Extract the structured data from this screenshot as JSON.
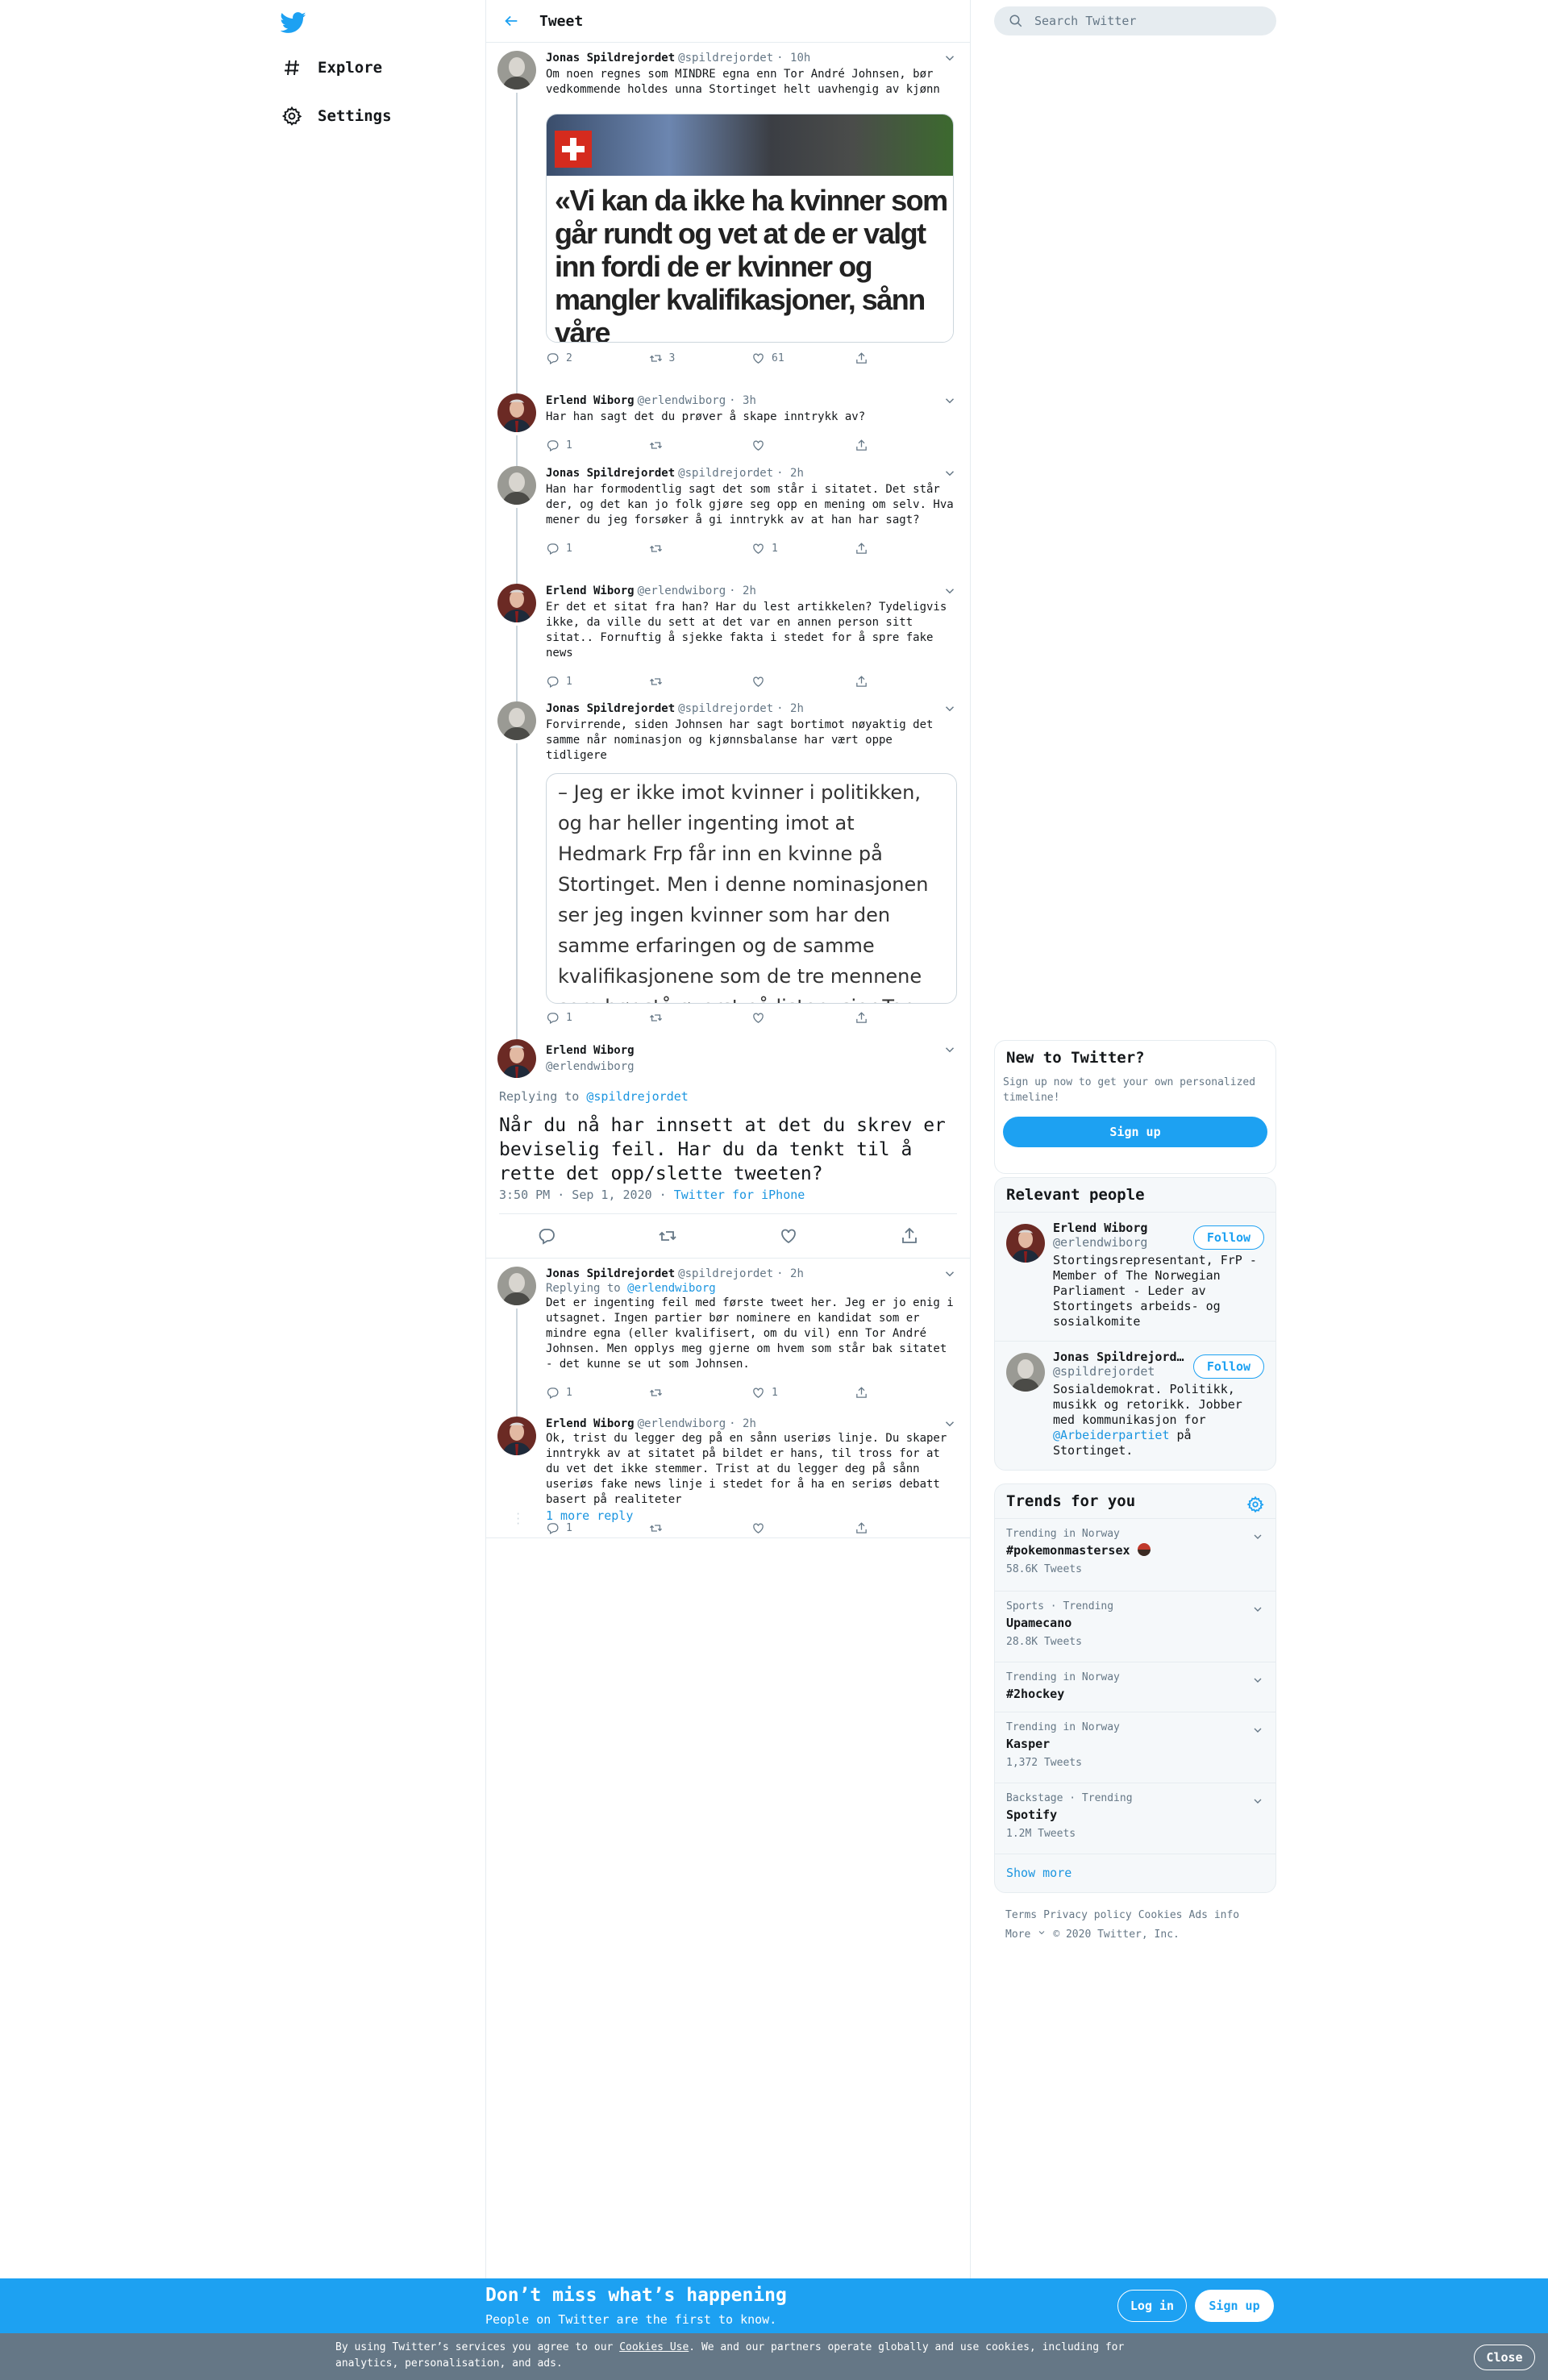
{
  "nav": {
    "explore_label": "Explore",
    "settings_label": "Settings"
  },
  "header": {
    "title": "Tweet"
  },
  "search": {
    "placeholder": "Search Twitter"
  },
  "tweets": [
    {
      "name": "Jonas Spildrejordet",
      "handle": "@spildrejordet",
      "time": "· 10h",
      "text": "Om noen regnes som MINDRE egna enn Tor André Johnsen, bør vedkommende holdes unna Stortinget helt uavhengig av kjønn",
      "media_text": "«Vi kan da ikke ha kvinner som går rundt og vet at de er valgt inn fordi de er kvinner og mangler kvalifikasjoner, sånn våre",
      "replies": "2",
      "retweets": "3",
      "likes": "61"
    },
    {
      "name": "Erlend Wiborg",
      "handle": "@erlendwiborg",
      "time": "· 3h",
      "text": "Har han sagt det du prøver å skape inntrykk av?",
      "replies": "1",
      "retweets": "",
      "likes": ""
    },
    {
      "name": "Jonas Spildrejordet",
      "handle": "@spildrejordet",
      "time": "· 2h",
      "text": "Han har formodentlig sagt det som står i sitatet. Det står der, og det kan jo folk gjøre seg opp en mening om selv. Hva mener du jeg forsøker å gi inntrykk av at han har sagt?",
      "replies": "1",
      "retweets": "",
      "likes": "1"
    },
    {
      "name": "Erlend Wiborg",
      "handle": "@erlendwiborg",
      "time": "· 2h",
      "text": "Er det et sitat fra han? Har du lest artikkelen? Tydeligvis ikke, da ville du sett at det var en annen person sitt sitat.. Fornuftig å sjekke fakta i stedet for å spre fake news",
      "replies": "1",
      "retweets": "",
      "likes": ""
    },
    {
      "name": "Jonas Spildrejordet",
      "handle": "@spildrejordet",
      "time": "· 2h",
      "text": "Forvirrende, siden Johnsen har sagt bortimot nøyaktig det samme når nominasjon og kjønnsbalanse har vært oppe tidligere",
      "media_text": "– Jeg er ikke imot kvinner i politikken, og har heller ingenting imot at Hedmark Frp får inn en kvinne på Stortinget. Men i denne nominasjonen ser jeg ingen kvinner som har den samme erfaringen og de samme kvalifikasjonene som de tre mennene som bør stå øverst på listen, sier Tor André Johnsen.",
      "replies": "1",
      "retweets": "",
      "likes": ""
    }
  ],
  "main_tweet": {
    "name": "Erlend Wiborg",
    "handle": "@erlendwiborg",
    "replying_label": "Replying to",
    "replying_handle": "@spildrejordet",
    "text": "Når du nå har innsett at det du skrev er beviselig feil. Har du da tenkt til å rette det opp/slette tweeten?",
    "timestamp": "3:50 PM · Sep 1, 2020 · ",
    "source": "Twitter for iPhone"
  },
  "replies": [
    {
      "name": "Jonas Spildrejordet",
      "handle": "@spildrejordet",
      "time": "· 2h",
      "replying_label": "Replying to",
      "replying_handle": "@erlendwiborg",
      "text": "Det er ingenting feil med første tweet her. Jeg er jo enig i utsagnet. Ingen partier bør nominere en kandidat som er mindre egna (eller kvalifisert, om du vil) enn Tor André Johnsen. Men opplys meg gjerne om hvem som står bak sitatet - det kunne se ut som Johnsen.",
      "replies": "1",
      "retweets": "",
      "likes": "1"
    },
    {
      "name": "Erlend Wiborg",
      "handle": "@erlendwiborg",
      "time": "· 2h",
      "text": "Ok, trist du legger deg på en sånn useriøs linje. Du skaper inntrykk av at sitatet på bildet er hans, til tross for at du vet det ikke stemmer. Trist at du legger deg på sånn useriøs fake news linje i stedet for å ha en seriøs debatt basert på realiteter",
      "replies": "1",
      "retweets": "",
      "likes": ""
    }
  ],
  "more_reply": "1 more reply",
  "new_to_twitter": {
    "title": "New to Twitter?",
    "text": "Sign up now to get your own personalized timeline!",
    "button": "Sign up"
  },
  "relevant": {
    "title": "Relevant people",
    "people": [
      {
        "name": "Erlend Wiborg",
        "handle": "@erlendwiborg",
        "follow": "Follow",
        "bio": "Stortingsrepresentant, FrP - Member of The Norwegian Parliament - Leder av Stortingets arbeids- og sosialkomite"
      },
      {
        "name": "Jonas Spildrejord…",
        "handle": "@spildrejordet",
        "follow": "Follow",
        "bio_pre": "Sosialdemokrat. Politikk, musikk og retorikk. Jobber med kommunikasjon for ",
        "bio_link": "@Arbeiderpartiet",
        "bio_post": " på Stortinget."
      }
    ]
  },
  "trends": {
    "title": "Trends for you",
    "items": [
      {
        "context": "Trending in Norway",
        "name": "#pokemonmastersex",
        "count": "58.6K Tweets"
      },
      {
        "context": "Sports · Trending",
        "name": "Upamecano",
        "count": "28.8K Tweets"
      },
      {
        "context": "Trending in Norway",
        "name": "#2hockey",
        "count": ""
      },
      {
        "context": "Trending in Norway",
        "name": "Kasper",
        "count": "1,372 Tweets"
      },
      {
        "context": "Backstage · Trending",
        "name": "Spotify",
        "count": "1.2M Tweets"
      }
    ],
    "show_more": "Show more"
  },
  "footer": {
    "terms": "Terms",
    "privacy": "Privacy policy",
    "cookies": "Cookies",
    "ads": "Ads info",
    "more": "More",
    "copyright": "© 2020 Twitter, Inc."
  },
  "banner": {
    "title": "Don’t miss what’s happening",
    "subtitle": "People on Twitter are the first to know.",
    "login": "Log in",
    "signup": "Sign up"
  },
  "cookie": {
    "pre": "By using Twitter’s services you agree to our ",
    "link": "Cookies Use",
    "post": ". We and our partners operate globally and use cookies, including for analytics, personalisation, and ads.",
    "close": "Close"
  },
  "colors": {
    "accent": "#1da1f2",
    "link": "#1b95e0",
    "secondary": "#657786",
    "border": "#e6ecf0"
  }
}
